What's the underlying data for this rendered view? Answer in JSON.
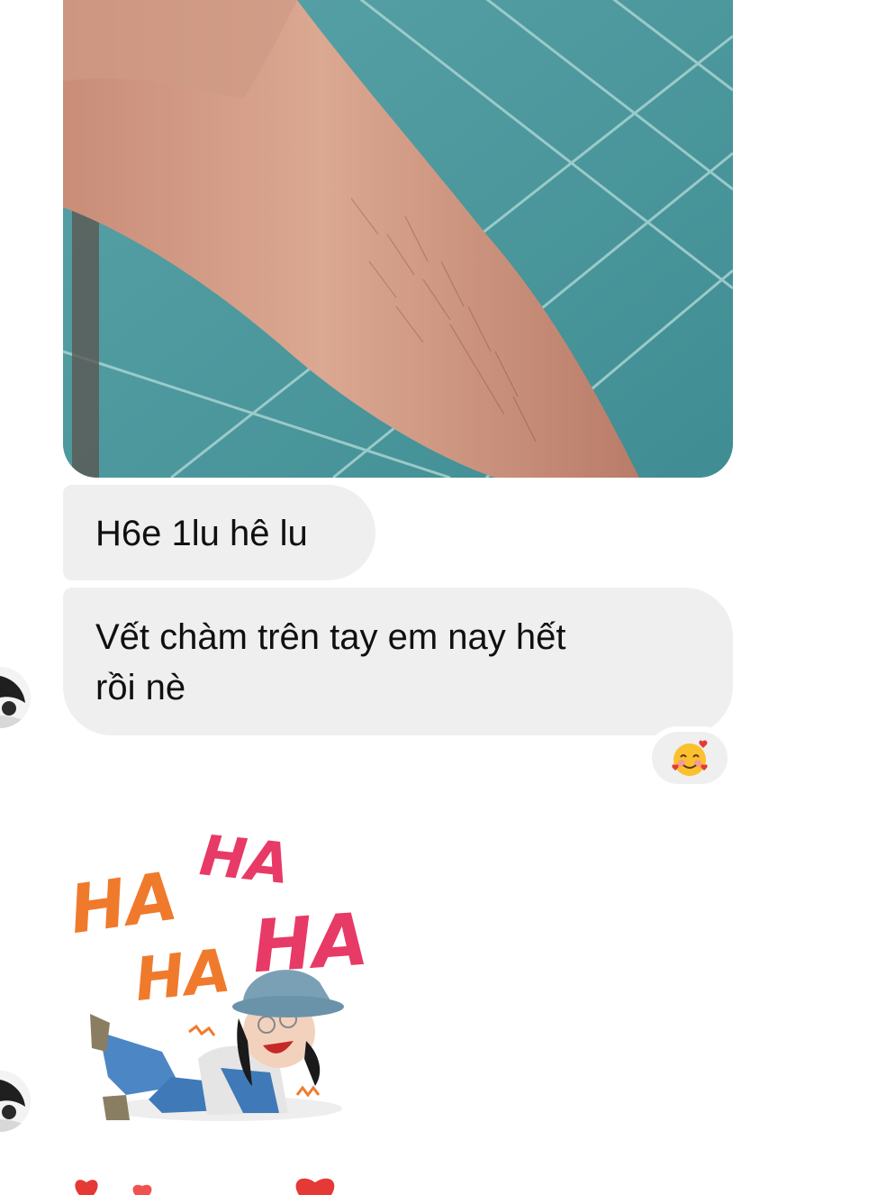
{
  "messages": [
    {
      "type": "image",
      "alt": "arm-photo"
    },
    {
      "type": "text",
      "text": "H6e 1lu hê lu"
    },
    {
      "type": "text",
      "text": "Vết chàm trên tay em nay hết\nrồi nè"
    }
  ],
  "reaction": {
    "emoji": "🥰",
    "icon": "smiling-face-with-hearts-icon"
  },
  "sticker": {
    "words": [
      "HA",
      "HA",
      "HA",
      "HA"
    ],
    "colors": {
      "orange": "#f07a2c",
      "pink": "#e83a66"
    }
  },
  "colors": {
    "bubble_bg": "#efefef",
    "text": "#101010",
    "tile": "#4f999d",
    "skin": "#d9a48a"
  }
}
